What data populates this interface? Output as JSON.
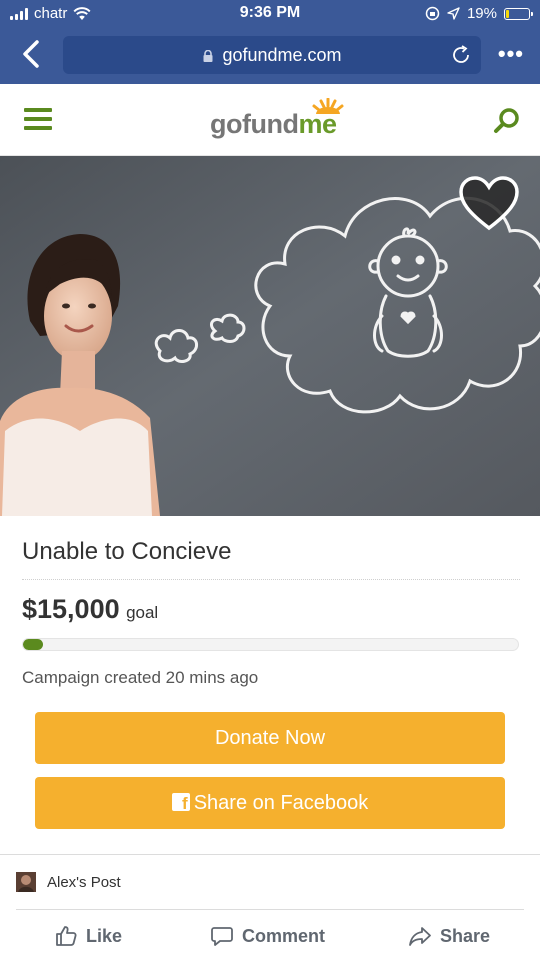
{
  "status_bar": {
    "carrier": "chatr",
    "time": "9:36 PM",
    "battery": "19%",
    "battery_level": 0.19
  },
  "browser": {
    "url": "gofundme.com"
  },
  "site": {
    "logo_part1": "gofund",
    "logo_part2": "me"
  },
  "campaign": {
    "title": "Unable to Concieve",
    "goal_amount": "$15,000",
    "goal_label": "goal",
    "progress": 0.04,
    "created": "Campaign created 20 mins ago",
    "donate_label": "Donate Now",
    "share_label": "Share on Facebook"
  },
  "facebook_post": {
    "author": "Alex's Post",
    "actions": {
      "like": "Like",
      "comment": "Comment",
      "share": "Share"
    }
  },
  "colors": {
    "facebook_blue": "#3b5998",
    "gofundme_green": "#5b8a1e",
    "button_orange": "#f5b02e"
  },
  "icons": [
    "signal-icon",
    "wifi-icon",
    "location-icon",
    "battery-icon",
    "back-icon",
    "lock-icon",
    "reload-icon",
    "more-icon",
    "menu-icon",
    "search-icon",
    "heart-icon",
    "facebook-icon",
    "like-icon",
    "comment-icon",
    "share-icon"
  ]
}
